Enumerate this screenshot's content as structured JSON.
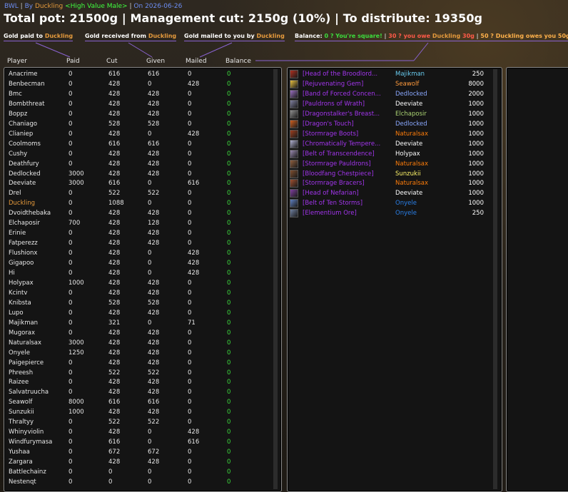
{
  "header": {
    "addon": "BWL",
    "by_prefix": "By",
    "author": "Duckling",
    "guild": "<High Value Male>",
    "date_prefix": "On",
    "date": "2026-06-26",
    "title": "Total pot: 21500g | Management cut: 2150g (10%) | To distribute: 19350g"
  },
  "legend": {
    "paid_label": "Gold paid to",
    "paid_name": "Duckling",
    "received_label": "Gold received from",
    "received_name": "Duckling",
    "mailed_label": "Gold mailed to you by",
    "mailed_name": "Duckling",
    "balance_label": "Balance:",
    "square_text": "0 ? You're square!",
    "owe_prefix": "30 ? you owe",
    "owe_name": "Duckling",
    "owe_amount": "30g",
    "owed_prefix": "50 ? Duckling owes you",
    "owed_amount": "50g",
    "sep": "|"
  },
  "columns": [
    "Player",
    "Paid",
    "Cut",
    "Given",
    "Mailed",
    "Balance"
  ],
  "colors": {
    "epic": "#a335ee",
    "balance_zero": "#3cdc3c",
    "self_name": "#e59a3c",
    "accent_line": "#8a63d2"
  },
  "players": [
    {
      "name": "Anacrime",
      "paid": "0",
      "cut": "616",
      "given": "616",
      "mailed": "0",
      "balance": "0"
    },
    {
      "name": "Benbecman",
      "paid": "0",
      "cut": "428",
      "given": "0",
      "mailed": "428",
      "balance": "0"
    },
    {
      "name": "Bmc",
      "paid": "0",
      "cut": "428",
      "given": "428",
      "mailed": "0",
      "balance": "0"
    },
    {
      "name": "Bombthreat",
      "paid": "0",
      "cut": "428",
      "given": "428",
      "mailed": "0",
      "balance": "0"
    },
    {
      "name": "Boppz",
      "paid": "0",
      "cut": "428",
      "given": "428",
      "mailed": "0",
      "balance": "0"
    },
    {
      "name": "Chaniago",
      "paid": "0",
      "cut": "528",
      "given": "528",
      "mailed": "0",
      "balance": "0"
    },
    {
      "name": "Clianiep",
      "paid": "0",
      "cut": "428",
      "given": "0",
      "mailed": "428",
      "balance": "0"
    },
    {
      "name": "Coolmoms",
      "paid": "0",
      "cut": "616",
      "given": "616",
      "mailed": "0",
      "balance": "0"
    },
    {
      "name": "Cushy",
      "paid": "0",
      "cut": "428",
      "given": "428",
      "mailed": "0",
      "balance": "0"
    },
    {
      "name": "Deathfury",
      "paid": "0",
      "cut": "428",
      "given": "428",
      "mailed": "0",
      "balance": "0"
    },
    {
      "name": "Dedlocked",
      "paid": "3000",
      "cut": "428",
      "given": "428",
      "mailed": "0",
      "balance": "0"
    },
    {
      "name": "Deeviate",
      "paid": "3000",
      "cut": "616",
      "given": "0",
      "mailed": "616",
      "balance": "0"
    },
    {
      "name": "Drel",
      "paid": "0",
      "cut": "522",
      "given": "522",
      "mailed": "0",
      "balance": "0"
    },
    {
      "name": "Duckling",
      "paid": "0",
      "cut": "1088",
      "given": "0",
      "mailed": "0",
      "balance": "0",
      "self": true
    },
    {
      "name": "Dvoidthebaka",
      "paid": "0",
      "cut": "428",
      "given": "428",
      "mailed": "0",
      "balance": "0"
    },
    {
      "name": "Elchaposir",
      "paid": "700",
      "cut": "428",
      "given": "128",
      "mailed": "0",
      "balance": "0"
    },
    {
      "name": "Erinie",
      "paid": "0",
      "cut": "428",
      "given": "428",
      "mailed": "0",
      "balance": "0"
    },
    {
      "name": "Fatperezz",
      "paid": "0",
      "cut": "428",
      "given": "428",
      "mailed": "0",
      "balance": "0"
    },
    {
      "name": "Flushionx",
      "paid": "0",
      "cut": "428",
      "given": "0",
      "mailed": "428",
      "balance": "0"
    },
    {
      "name": "Gigapoo",
      "paid": "0",
      "cut": "428",
      "given": "0",
      "mailed": "428",
      "balance": "0"
    },
    {
      "name": "Hi",
      "paid": "0",
      "cut": "428",
      "given": "0",
      "mailed": "428",
      "balance": "0"
    },
    {
      "name": "Holypax",
      "paid": "1000",
      "cut": "428",
      "given": "428",
      "mailed": "0",
      "balance": "0"
    },
    {
      "name": "Kcintv",
      "paid": "0",
      "cut": "428",
      "given": "428",
      "mailed": "0",
      "balance": "0"
    },
    {
      "name": "Knibsta",
      "paid": "0",
      "cut": "528",
      "given": "528",
      "mailed": "0",
      "balance": "0"
    },
    {
      "name": "Lupo",
      "paid": "0",
      "cut": "428",
      "given": "428",
      "mailed": "0",
      "balance": "0"
    },
    {
      "name": "Majikman",
      "paid": "0",
      "cut": "321",
      "given": "0",
      "mailed": "71",
      "balance": "0"
    },
    {
      "name": "Mugorax",
      "paid": "0",
      "cut": "428",
      "given": "428",
      "mailed": "0",
      "balance": "0"
    },
    {
      "name": "Naturalsax",
      "paid": "3000",
      "cut": "428",
      "given": "428",
      "mailed": "0",
      "balance": "0"
    },
    {
      "name": "Onyele",
      "paid": "1250",
      "cut": "428",
      "given": "428",
      "mailed": "0",
      "balance": "0"
    },
    {
      "name": "Paigepierce",
      "paid": "0",
      "cut": "428",
      "given": "428",
      "mailed": "0",
      "balance": "0"
    },
    {
      "name": "Phreesh",
      "paid": "0",
      "cut": "522",
      "given": "522",
      "mailed": "0",
      "balance": "0"
    },
    {
      "name": "Raizee",
      "paid": "0",
      "cut": "428",
      "given": "428",
      "mailed": "0",
      "balance": "0"
    },
    {
      "name": "Salvatruucha",
      "paid": "0",
      "cut": "428",
      "given": "428",
      "mailed": "0",
      "balance": "0"
    },
    {
      "name": "Seawolf",
      "paid": "8000",
      "cut": "616",
      "given": "616",
      "mailed": "0",
      "balance": "0"
    },
    {
      "name": "Sunzukii",
      "paid": "1000",
      "cut": "428",
      "given": "428",
      "mailed": "0",
      "balance": "0"
    },
    {
      "name": "Thraltyy",
      "paid": "0",
      "cut": "522",
      "given": "522",
      "mailed": "0",
      "balance": "0"
    },
    {
      "name": "Whinyviolin",
      "paid": "0",
      "cut": "428",
      "given": "0",
      "mailed": "428",
      "balance": "0"
    },
    {
      "name": "Windfurymasa",
      "paid": "0",
      "cut": "616",
      "given": "0",
      "mailed": "616",
      "balance": "0"
    },
    {
      "name": "Yushaa",
      "paid": "0",
      "cut": "672",
      "given": "672",
      "mailed": "0",
      "balance": "0"
    },
    {
      "name": "Zargara",
      "paid": "0",
      "cut": "428",
      "given": "428",
      "mailed": "0",
      "balance": "0"
    },
    {
      "name": "Battlechainz",
      "paid": "0",
      "cut": "0",
      "given": "0",
      "mailed": "0",
      "balance": "0"
    },
    {
      "name": "Nestenqt",
      "paid": "0",
      "cut": "0",
      "given": "0",
      "mailed": "0",
      "balance": "0"
    }
  ],
  "items": [
    {
      "name": "[Head of the Broodlord...",
      "winner": "Majikman",
      "winner_color": "#69ccf0",
      "gold": "250",
      "icon": "skull-icon",
      "icon_color": "#b03020"
    },
    {
      "name": "[Rejuvenating Gem]",
      "winner": "Seawolf",
      "winner_color": "#ff9a3c",
      "gold": "8000",
      "icon": "gem-icon",
      "icon_color": "#e8c040"
    },
    {
      "name": "[Band of Forced Concen...",
      "winner": "Dedlocked",
      "winner_color": "#8aa8ff",
      "gold": "2000",
      "icon": "ring-icon",
      "icon_color": "#9a70c0"
    },
    {
      "name": "[Pauldrons of Wrath]",
      "winner": "Deeviate",
      "winner_color": "#ffffff",
      "gold": "1000",
      "icon": "shoulder-icon",
      "icon_color": "#8080a0"
    },
    {
      "name": "[Dragonstalker's Breast...",
      "winner": "Elchaposir",
      "winner_color": "#abd473",
      "gold": "1000",
      "icon": "chest-icon",
      "icon_color": "#909090"
    },
    {
      "name": "[Dragon's Touch]",
      "winner": "Dedlocked",
      "winner_color": "#8aa8ff",
      "gold": "1000",
      "icon": "wand-icon",
      "icon_color": "#d06020"
    },
    {
      "name": "[Stormrage Boots]",
      "winner": "Naturalsax",
      "winner_color": "#ff7d0a",
      "gold": "1000",
      "icon": "boots-icon",
      "icon_color": "#a04020"
    },
    {
      "name": "[Chromatically Tempere...",
      "winner": "Deeviate",
      "winner_color": "#ffffff",
      "gold": "1000",
      "icon": "gauntlets-icon",
      "icon_color": "#b0b0d0"
    },
    {
      "name": "[Belt of Transcendence]",
      "winner": "Holypax",
      "winner_color": "#ffffff",
      "gold": "1000",
      "icon": "belt-icon",
      "icon_color": "#9a8ab0"
    },
    {
      "name": "[Stormrage Pauldrons]",
      "winner": "Naturalsax",
      "winner_color": "#ff7d0a",
      "gold": "1000",
      "icon": "shoulder-icon",
      "icon_color": "#906040"
    },
    {
      "name": "[Bloodfang Chestpiece]",
      "winner": "Sunzukii",
      "winner_color": "#fff569",
      "gold": "1000",
      "icon": "chest-icon",
      "icon_color": "#805030"
    },
    {
      "name": "[Stormrage Bracers]",
      "winner": "Naturalsax",
      "winner_color": "#ff7d0a",
      "gold": "1000",
      "icon": "bracers-icon",
      "icon_color": "#a05030"
    },
    {
      "name": "[Head of Nefarian]",
      "winner": "Deeviate",
      "winner_color": "#ffffff",
      "gold": "1000",
      "icon": "skull-icon",
      "icon_color": "#8040a0"
    },
    {
      "name": "[Belt of Ten Storms]",
      "winner": "Onyele",
      "winner_color": "#2a7fe8",
      "gold": "1000",
      "icon": "belt-icon",
      "icon_color": "#6080c0"
    },
    {
      "name": "[Elementium Ore]",
      "winner": "Onyele",
      "winner_color": "#2a7fe8",
      "gold": "250",
      "icon": "ore-icon",
      "icon_color": "#7080a0"
    }
  ]
}
